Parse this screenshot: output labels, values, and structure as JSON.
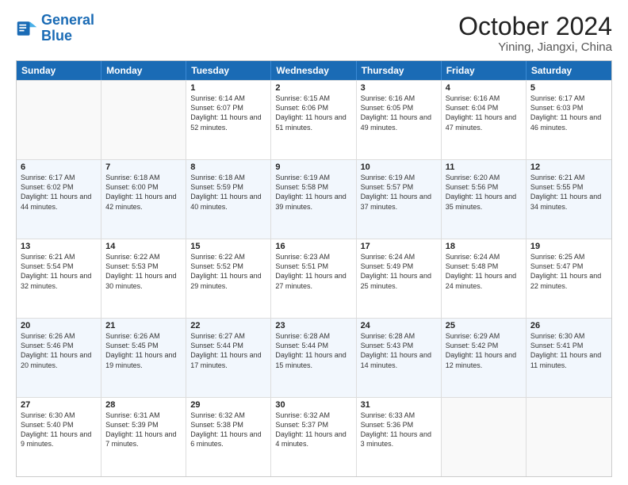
{
  "header": {
    "logo_general": "General",
    "logo_blue": "Blue",
    "title": "October 2024",
    "subtitle": "Yining, Jiangxi, China"
  },
  "weekdays": [
    "Sunday",
    "Monday",
    "Tuesday",
    "Wednesday",
    "Thursday",
    "Friday",
    "Saturday"
  ],
  "rows": [
    [
      {
        "day": "",
        "text": ""
      },
      {
        "day": "",
        "text": ""
      },
      {
        "day": "1",
        "text": "Sunrise: 6:14 AM\nSunset: 6:07 PM\nDaylight: 11 hours and 52 minutes."
      },
      {
        "day": "2",
        "text": "Sunrise: 6:15 AM\nSunset: 6:06 PM\nDaylight: 11 hours and 51 minutes."
      },
      {
        "day": "3",
        "text": "Sunrise: 6:16 AM\nSunset: 6:05 PM\nDaylight: 11 hours and 49 minutes."
      },
      {
        "day": "4",
        "text": "Sunrise: 6:16 AM\nSunset: 6:04 PM\nDaylight: 11 hours and 47 minutes."
      },
      {
        "day": "5",
        "text": "Sunrise: 6:17 AM\nSunset: 6:03 PM\nDaylight: 11 hours and 46 minutes."
      }
    ],
    [
      {
        "day": "6",
        "text": "Sunrise: 6:17 AM\nSunset: 6:02 PM\nDaylight: 11 hours and 44 minutes."
      },
      {
        "day": "7",
        "text": "Sunrise: 6:18 AM\nSunset: 6:00 PM\nDaylight: 11 hours and 42 minutes."
      },
      {
        "day": "8",
        "text": "Sunrise: 6:18 AM\nSunset: 5:59 PM\nDaylight: 11 hours and 40 minutes."
      },
      {
        "day": "9",
        "text": "Sunrise: 6:19 AM\nSunset: 5:58 PM\nDaylight: 11 hours and 39 minutes."
      },
      {
        "day": "10",
        "text": "Sunrise: 6:19 AM\nSunset: 5:57 PM\nDaylight: 11 hours and 37 minutes."
      },
      {
        "day": "11",
        "text": "Sunrise: 6:20 AM\nSunset: 5:56 PM\nDaylight: 11 hours and 35 minutes."
      },
      {
        "day": "12",
        "text": "Sunrise: 6:21 AM\nSunset: 5:55 PM\nDaylight: 11 hours and 34 minutes."
      }
    ],
    [
      {
        "day": "13",
        "text": "Sunrise: 6:21 AM\nSunset: 5:54 PM\nDaylight: 11 hours and 32 minutes."
      },
      {
        "day": "14",
        "text": "Sunrise: 6:22 AM\nSunset: 5:53 PM\nDaylight: 11 hours and 30 minutes."
      },
      {
        "day": "15",
        "text": "Sunrise: 6:22 AM\nSunset: 5:52 PM\nDaylight: 11 hours and 29 minutes."
      },
      {
        "day": "16",
        "text": "Sunrise: 6:23 AM\nSunset: 5:51 PM\nDaylight: 11 hours and 27 minutes."
      },
      {
        "day": "17",
        "text": "Sunrise: 6:24 AM\nSunset: 5:49 PM\nDaylight: 11 hours and 25 minutes."
      },
      {
        "day": "18",
        "text": "Sunrise: 6:24 AM\nSunset: 5:48 PM\nDaylight: 11 hours and 24 minutes."
      },
      {
        "day": "19",
        "text": "Sunrise: 6:25 AM\nSunset: 5:47 PM\nDaylight: 11 hours and 22 minutes."
      }
    ],
    [
      {
        "day": "20",
        "text": "Sunrise: 6:26 AM\nSunset: 5:46 PM\nDaylight: 11 hours and 20 minutes."
      },
      {
        "day": "21",
        "text": "Sunrise: 6:26 AM\nSunset: 5:45 PM\nDaylight: 11 hours and 19 minutes."
      },
      {
        "day": "22",
        "text": "Sunrise: 6:27 AM\nSunset: 5:44 PM\nDaylight: 11 hours and 17 minutes."
      },
      {
        "day": "23",
        "text": "Sunrise: 6:28 AM\nSunset: 5:44 PM\nDaylight: 11 hours and 15 minutes."
      },
      {
        "day": "24",
        "text": "Sunrise: 6:28 AM\nSunset: 5:43 PM\nDaylight: 11 hours and 14 minutes."
      },
      {
        "day": "25",
        "text": "Sunrise: 6:29 AM\nSunset: 5:42 PM\nDaylight: 11 hours and 12 minutes."
      },
      {
        "day": "26",
        "text": "Sunrise: 6:30 AM\nSunset: 5:41 PM\nDaylight: 11 hours and 11 minutes."
      }
    ],
    [
      {
        "day": "27",
        "text": "Sunrise: 6:30 AM\nSunset: 5:40 PM\nDaylight: 11 hours and 9 minutes."
      },
      {
        "day": "28",
        "text": "Sunrise: 6:31 AM\nSunset: 5:39 PM\nDaylight: 11 hours and 7 minutes."
      },
      {
        "day": "29",
        "text": "Sunrise: 6:32 AM\nSunset: 5:38 PM\nDaylight: 11 hours and 6 minutes."
      },
      {
        "day": "30",
        "text": "Sunrise: 6:32 AM\nSunset: 5:37 PM\nDaylight: 11 hours and 4 minutes."
      },
      {
        "day": "31",
        "text": "Sunrise: 6:33 AM\nSunset: 5:36 PM\nDaylight: 11 hours and 3 minutes."
      },
      {
        "day": "",
        "text": ""
      },
      {
        "day": "",
        "text": ""
      }
    ]
  ]
}
